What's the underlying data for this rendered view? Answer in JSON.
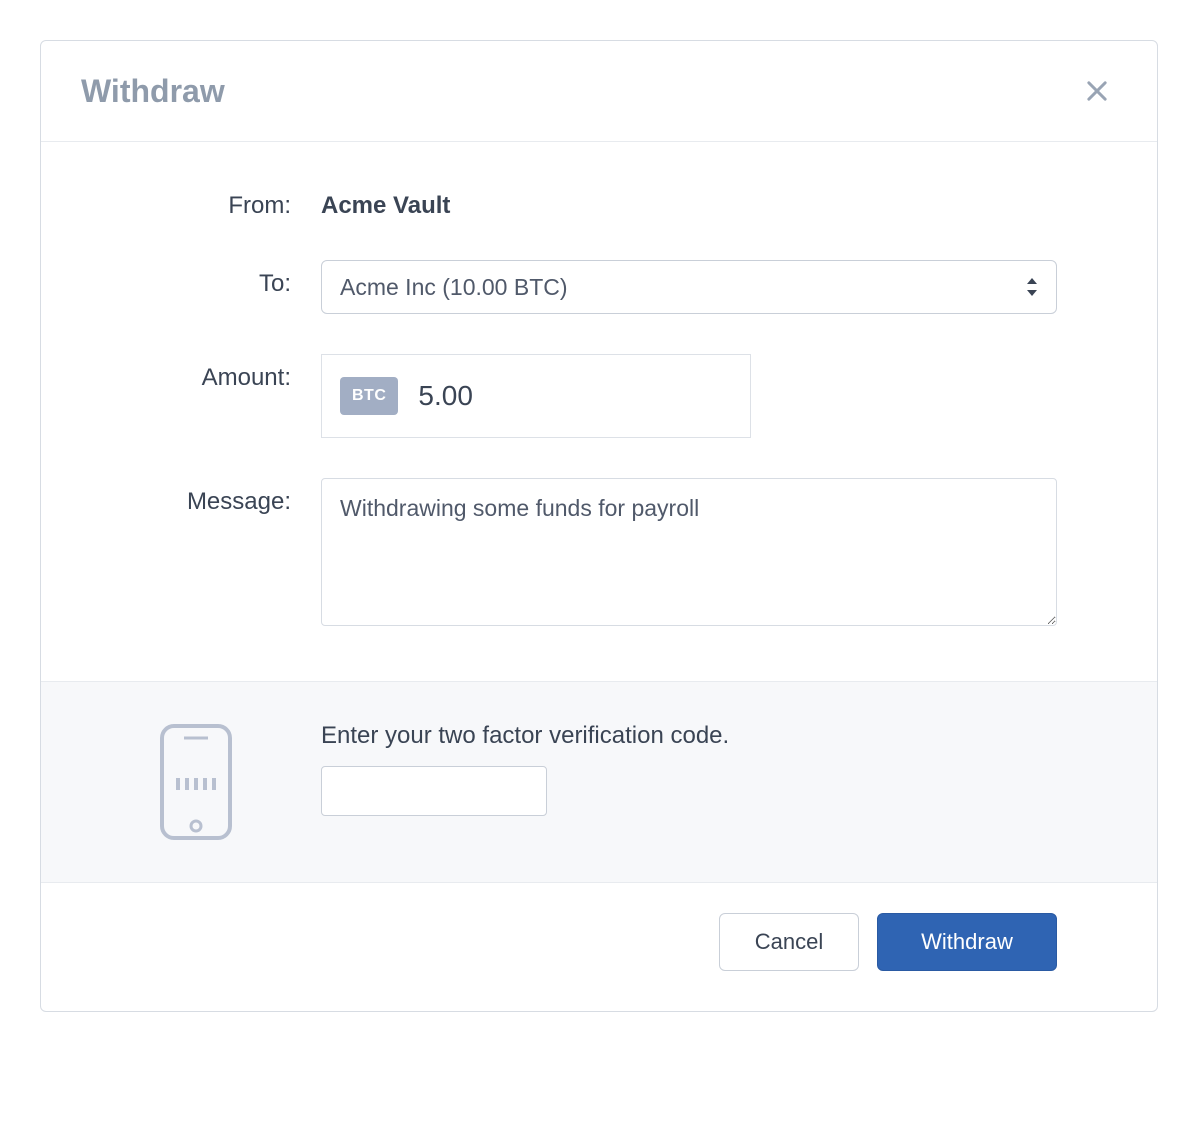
{
  "modal": {
    "title": "Withdraw"
  },
  "form": {
    "from_label": "From:",
    "from_value": "Acme Vault",
    "to_label": "To:",
    "to_selected": "Acme Inc (10.00 BTC)",
    "amount_label": "Amount:",
    "amount_currency": "BTC",
    "amount_value": "5.00",
    "message_label": "Message:",
    "message_value": "Withdrawing some funds for payroll"
  },
  "two_factor": {
    "label": "Enter your two factor verification code.",
    "value": ""
  },
  "footer": {
    "cancel_label": "Cancel",
    "submit_label": "Withdraw"
  }
}
